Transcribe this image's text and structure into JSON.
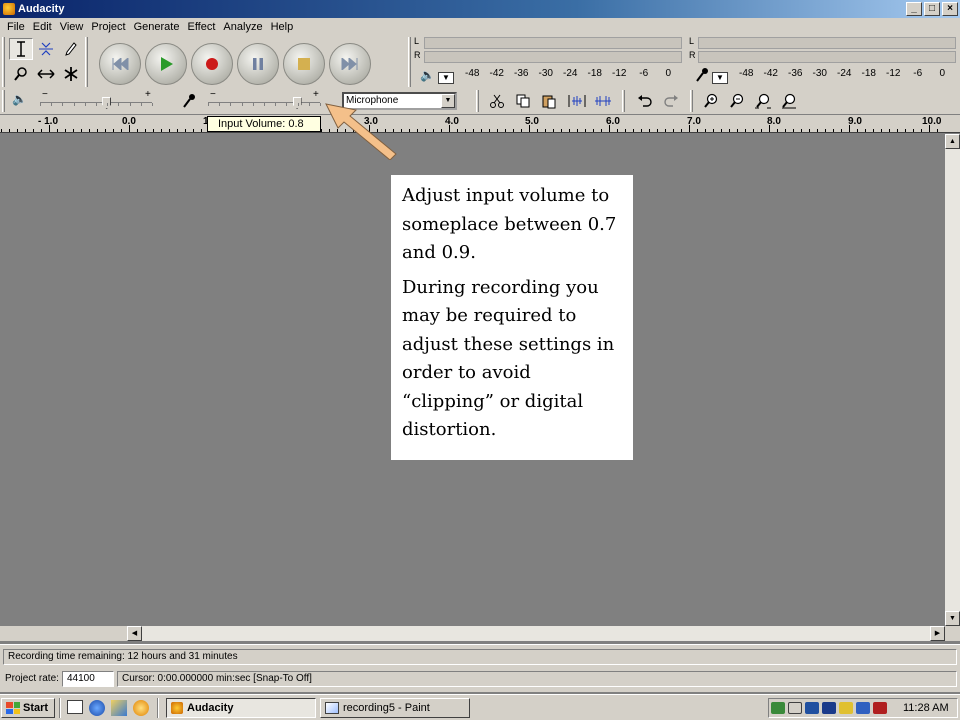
{
  "window": {
    "title": "Audacity",
    "buttons": [
      "_",
      "□",
      "×"
    ]
  },
  "menu": [
    "File",
    "Edit",
    "View",
    "Project",
    "Generate",
    "Effect",
    "Analyze",
    "Help"
  ],
  "meters": {
    "output_scale": [
      "-48",
      "-42",
      "-36",
      "-30",
      "-24",
      "-18",
      "-12",
      "-6",
      "0"
    ],
    "input_scale": [
      "-48",
      "-42",
      "-36",
      "-30",
      "-24",
      "-18",
      "-12",
      "-6",
      "0"
    ],
    "channel_l": "L",
    "channel_r": "R"
  },
  "mixer": {
    "output_volume": 0.6,
    "input_volume": 0.8,
    "minus": "−",
    "plus": "+",
    "input_source": "Microphone"
  },
  "ruler": [
    "- 1.0",
    "0.0",
    "1",
    "3.0",
    "4.0",
    "5.0",
    "6.0",
    "7.0",
    "8.0",
    "9.0",
    "10.0"
  ],
  "tooltip": "Input Volume: 0.8",
  "callout": {
    "para1": "Adjust input volume to someplace between 0.7 and 0.9.",
    "para2": "During recording you may be required to adjust these settings in order to avoid “clipping” or digital distortion."
  },
  "status": {
    "recording_time": "Recording time remaining: 12 hours and 31 minutes",
    "project_rate_label": "Project rate:",
    "project_rate": "44100",
    "cursor": "Cursor: 0:00.000000 min:sec   [Snap-To Off]"
  },
  "taskbar": {
    "start": "Start",
    "tasks": [
      "Audacity",
      "recording5 - Paint"
    ],
    "clock": "11:28 AM"
  },
  "colors": {
    "accent": "#0a246a",
    "callout_arrow": "#f4c08a"
  }
}
